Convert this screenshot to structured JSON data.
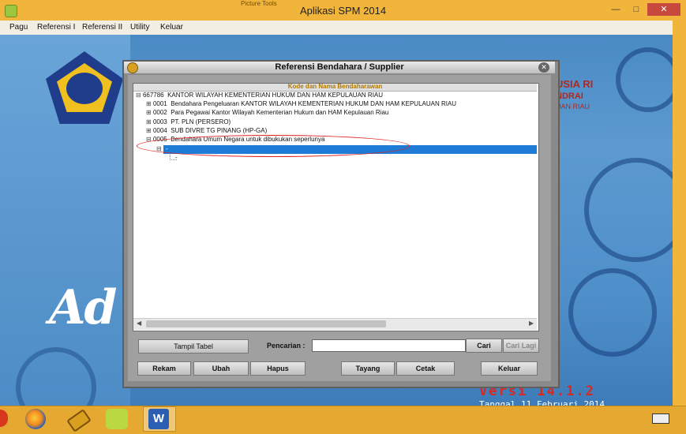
{
  "window": {
    "title": "Aplikasi SPM 2014",
    "picture_tools": "Picture Tools"
  },
  "menu": [
    "Pagu",
    "Referensi I",
    "Referensi II",
    "Utility",
    "Keluar"
  ],
  "background": {
    "brand_line1": "USIA RI",
    "brand_line2": "NDRAI",
    "brand_line3": "UAN RIAU",
    "ad_text": "Ad",
    "version": "Versi 14.1.2",
    "date": "Tanggal 11 Februari 2014"
  },
  "dialog": {
    "title": "Referensi Bendahara / Supplier",
    "tree_header": "Kode dan Nama Bendaharawan",
    "tree": [
      {
        "expander": "⊟",
        "code": "667786",
        "name": "KANTOR WILAYAH KEMENTERIAN HUKUM DAN HAM KEPULAUAN RIAU"
      },
      {
        "expander": "⊞",
        "code": "0001",
        "name": "Bendahara Pengeluaran KANTOR WILAYAH KEMENTERIAN HUKUM DAN HAM KEPULAUAN RIAU"
      },
      {
        "expander": "⊞",
        "code": "0002",
        "name": "Para Pegawai Kantor Wilayah Kementerian Hukum dan HAM Kepulauan Riau"
      },
      {
        "expander": "⊞",
        "code": "0003",
        "name": "PT. PLN (PERSERO)"
      },
      {
        "expander": "⊞",
        "code": "0004",
        "name": "SUB DIVRE TG PINANG (HP-GA)"
      },
      {
        "expander": "⊟",
        "code": "0005",
        "name": "Bendahara Umum Negara untuk dibukukan seperlunya"
      }
    ],
    "selected_child": "-",
    "child2": "-",
    "tampil_tabel": "Tampil Tabel",
    "search_label": "Pencarian :",
    "search_value": "",
    "cari": "Cari",
    "cari_lagi": "Cari Lagi",
    "buttons": [
      "Rekam",
      "Ubah",
      "Hapus",
      "Tayang",
      "Cetak",
      "Keluar"
    ]
  },
  "colors": {
    "titlebar": "#f2b53c",
    "selection": "#1e7bd6",
    "annotation": "#d22222",
    "version_text": "#d9291f"
  }
}
